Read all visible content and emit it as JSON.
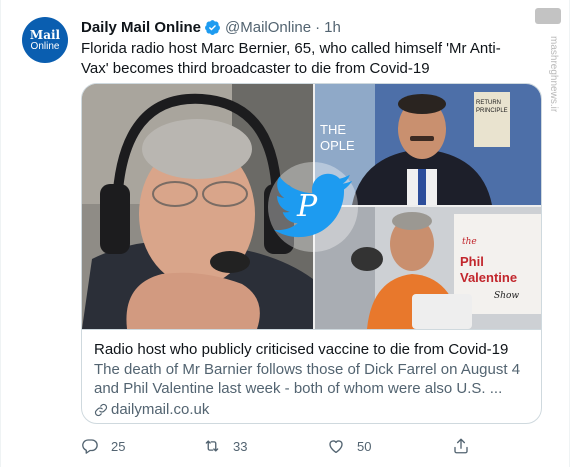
{
  "author": {
    "avatar_line1": "Mail",
    "avatar_line2": "Online",
    "display_name": "Daily Mail Online",
    "handle": "@MailOnline",
    "separator": "·",
    "time": "1h"
  },
  "tweet": {
    "text": "Florida radio host Marc Bernier, 65, who called himself 'Mr Anti-Vax' becomes third broadcaster to die from Covid-19"
  },
  "card": {
    "image_texts": {
      "sign1": "THE",
      "sign2": "OPLE",
      "book_line1": "RETURN",
      "book_line2": "PRINCIPLE",
      "show_the": "the",
      "show_name1": "Phil",
      "show_name2": "Valentine",
      "show_word": "Show"
    },
    "title": "Radio host who publicly criticised vaccine to die from Covid-19",
    "description": "The death of Mr Barnier follows those of Dick Farrel on August 4 and Phil Valentine last week - both of whom were also U.S. ...",
    "domain": "dailymail.co.uk"
  },
  "actions": {
    "replies": "25",
    "retweets": "33",
    "likes": "50"
  },
  "watermark": {
    "text": "mashreghnews.ir"
  },
  "icons": {
    "verified": "verified-badge-icon",
    "link": "link-icon",
    "reply": "reply-icon",
    "retweet": "retweet-icon",
    "like": "heart-icon",
    "share": "share-icon",
    "overlay": "twitter-bird-logo-icon"
  },
  "colors": {
    "accent": "#1d9bf0",
    "secondary_text": "#536471",
    "primary_text": "#0f1419",
    "border": "#cfd9de",
    "avatar_bg": "#0a5eb0"
  }
}
